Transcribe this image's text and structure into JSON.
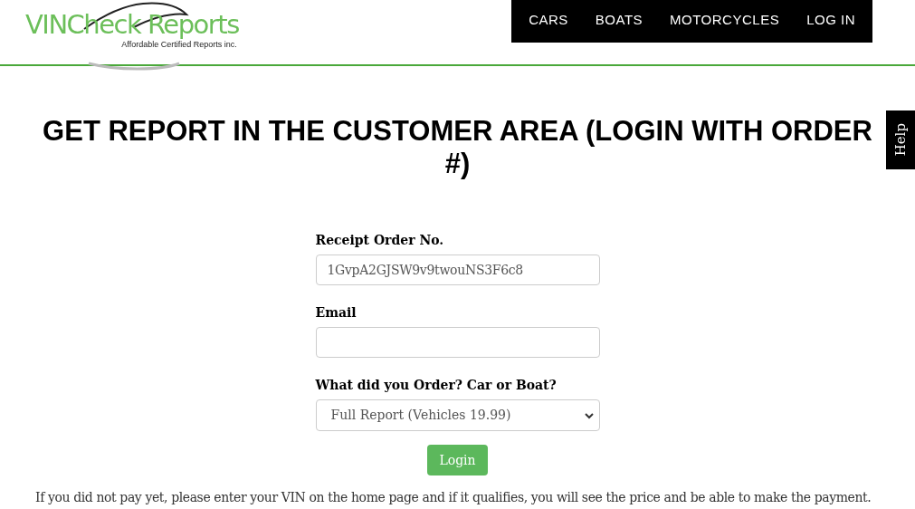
{
  "logo": {
    "title": "VINCheck Reports",
    "tagline": "Affordable Certified Reports inc."
  },
  "nav": [
    {
      "label": "CARS"
    },
    {
      "label": "BOATS"
    },
    {
      "label": "MOTORCYCLES"
    },
    {
      "label": "LOG IN"
    }
  ],
  "help_tab": "Help",
  "heading": "GET REPORT IN THE CUSTOMER AREA (LOGIN WITH ORDER #)",
  "form": {
    "fields": [
      {
        "kind": "text",
        "label": "Receipt Order No.",
        "value": "1GvpA2GJSW9v9twouNS3F6c8"
      },
      {
        "kind": "text",
        "label": "Email"
      },
      {
        "kind": "select",
        "label": "What did you Order? Car or Boat?",
        "value": "Full Report (Vehicles 19.99)"
      }
    ],
    "submit": "Login"
  },
  "note": "If you did not pay yet, please enter your VIN on the home page and if it qualifies, you will see the price and be able to make the payment."
}
